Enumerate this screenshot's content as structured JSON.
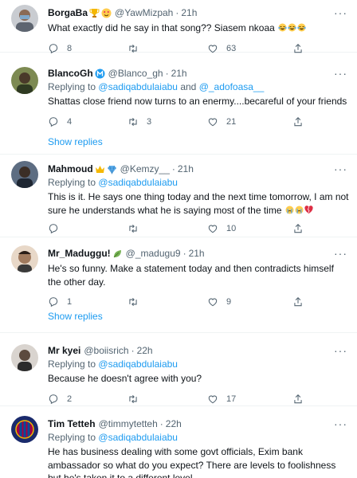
{
  "tweets": [
    {
      "name": "BorgaBa",
      "handle": "@YawMizpah",
      "time": "21h",
      "reply_prefix": "",
      "reply_to": [],
      "text": "What exactly did he say in that song?? Siasem nkoaa",
      "counts": {
        "reply": "8",
        "retweet": "",
        "like": "63"
      },
      "avatar_color": "#8a8f98"
    },
    {
      "name": "BlancoGh",
      "handle": "@Blanco_gh",
      "time": "21h",
      "reply_prefix": "Replying to",
      "reply_to": [
        "@sadiqabdulaiabu",
        "and",
        "@_adofoasa__"
      ],
      "text": "Shattas close friend now turns to an enermy....becareful of your friends",
      "counts": {
        "reply": "4",
        "retweet": "3",
        "like": "21"
      },
      "show_replies": "Show replies",
      "avatar_color": "#6b7a4a"
    },
    {
      "name": "Mahmoud",
      "handle": "@Kemzy__",
      "time": "21h",
      "reply_prefix": "Replying to",
      "reply_to": [
        "@sadiqabdulaiabu"
      ],
      "text": "This is it. He says one thing today and the next time tomorrow, I am not sure he understands what he is saying most of the time",
      "counts": {
        "reply": "",
        "retweet": "",
        "like": "10"
      },
      "avatar_color": "#4a5a6e"
    },
    {
      "name": "Mr_Maduggu!",
      "handle": "@_madugu9",
      "time": "21h",
      "reply_prefix": "",
      "reply_to": [],
      "text": "He's so funny. Make a statement today and then contradicts himself the other day.",
      "counts": {
        "reply": "1",
        "retweet": "",
        "like": "9"
      },
      "show_replies": "Show replies",
      "avatar_color": "#a07a5e"
    },
    {
      "name": "Mr kyei",
      "handle": "@boiisrich",
      "time": "22h",
      "reply_prefix": "Replying to",
      "reply_to": [
        "@sadiqabdulaiabu"
      ],
      "text": "Because he doesn't agree with you?",
      "counts": {
        "reply": "2",
        "retweet": "",
        "like": "17"
      },
      "avatar_color": "#5c4a3e"
    },
    {
      "name": "Tim Tetteh",
      "handle": "@timmytetteh",
      "time": "22h",
      "reply_prefix": "Replying to",
      "reply_to": [
        "@sadiqabdulaiabu"
      ],
      "text": "He has business dealing with some govt officials, Exim bank ambassador so what do you expect? There are levels to foolishness but he's taken it to a different level.",
      "counts": {
        "reply": "",
        "retweet": "",
        "like": ""
      },
      "avatar_color": "#2b3a8c"
    }
  ],
  "colors": {
    "accent": "#1d9bf0",
    "muted": "#536471",
    "text": "#0f1419"
  },
  "icons": [
    "reply-icon",
    "retweet-icon",
    "like-icon",
    "share-icon",
    "more-icon"
  ]
}
